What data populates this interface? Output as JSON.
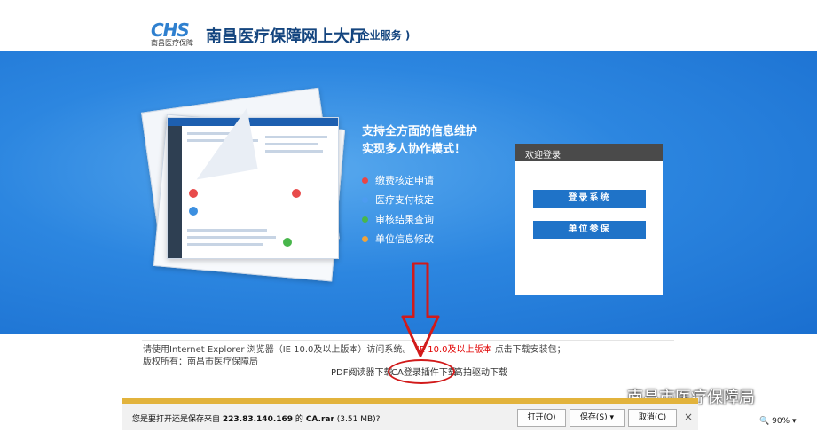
{
  "header": {
    "logo_letters": "CHS",
    "logo_sub": "南昌医疗保障",
    "title": "南昌医疗保障网上大厅",
    "subtitle": "( 企业服务 )"
  },
  "banner": {
    "headline_1": "支持全方面的信息维护",
    "headline_2": "实现多人协作模式！",
    "features": [
      {
        "label": "缴费核定申请",
        "color": "#e94545"
      },
      {
        "label": "医疗支付核定",
        "color": "#4d9cf0"
      },
      {
        "label": "审核结果查询",
        "color": "#48b64b"
      },
      {
        "label": "单位信息修改",
        "color": "#f0a33a"
      }
    ]
  },
  "login": {
    "title": "欢迎登录",
    "login_button": "登录系统",
    "enroll_button": "单位参保"
  },
  "footer": {
    "notice_prefix": "请使用Internet Explorer 浏览器（IE 10.0及以上版本）访问系统。",
    "notice_red": "IE 10.0及以上版本",
    "notice_suffix": "点击下载安装包；",
    "copyright": "版权所有：南昌市医疗保障局",
    "links": [
      "PDF阅读器下载",
      "CA登录插件下载",
      "高拍驱动下载"
    ]
  },
  "watermark": "南昌市医疗保障局",
  "download_bar": {
    "prompt_prefix": "您是要打开还是保存来自",
    "host": "223.83.140.169",
    "prompt_mid": "的",
    "filename": "CA.rar",
    "size": "(3.51 MB)?",
    "open_label": "打开(O)",
    "save_label": "保存(S)",
    "save_arrow": "▾",
    "cancel_label": "取消(C)",
    "close_glyph": "×"
  },
  "status": {
    "zoom": "90%",
    "zoom_icon": "🔍",
    "zoom_arrow": "▾"
  }
}
